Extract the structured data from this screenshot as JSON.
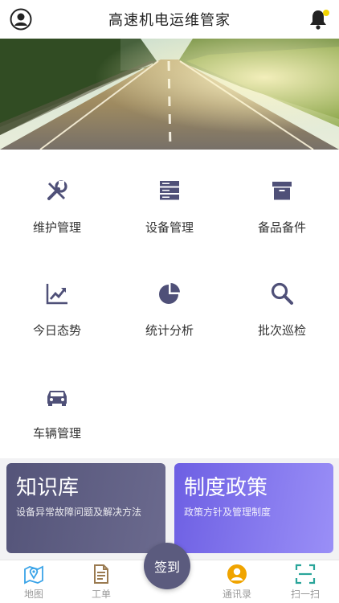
{
  "header": {
    "title": "高速机电运维管家",
    "avatar_icon": "user-circle-icon",
    "bell_icon": "bell-icon",
    "notification_dot_color": "#f2d400"
  },
  "banner": {
    "image": "highway-road-photo"
  },
  "grid": {
    "items": [
      {
        "label": "维护管理",
        "icon": "wrench-screwdriver-icon"
      },
      {
        "label": "设备管理",
        "icon": "server-rack-icon"
      },
      {
        "label": "备品备件",
        "icon": "archive-box-icon"
      },
      {
        "label": "今日态势",
        "icon": "trend-chart-icon"
      },
      {
        "label": "统计分析",
        "icon": "pie-chart-icon"
      },
      {
        "label": "批次巡检",
        "icon": "search-icon"
      },
      {
        "label": "车辆管理",
        "icon": "car-icon"
      }
    ]
  },
  "cards": {
    "knowledge": {
      "title": "知识库",
      "subtitle": "设备异常故障问题及解决方法"
    },
    "policy": {
      "title": "制度政策",
      "subtitle": "政策方针及管理制度"
    }
  },
  "tabbar": {
    "tabs": [
      {
        "label": "地图",
        "icon": "map-icon"
      },
      {
        "label": "工单",
        "icon": "document-icon"
      },
      {
        "label": "通讯录",
        "icon": "contacts-icon"
      },
      {
        "label": "扫一扫",
        "icon": "scan-icon"
      }
    ],
    "checkin_label": "签到"
  },
  "colors": {
    "icon_primary": "#4f5078",
    "accent_blue": "#3ba4e8",
    "accent_orange": "#f0a400",
    "accent_teal": "#2aa59a"
  }
}
